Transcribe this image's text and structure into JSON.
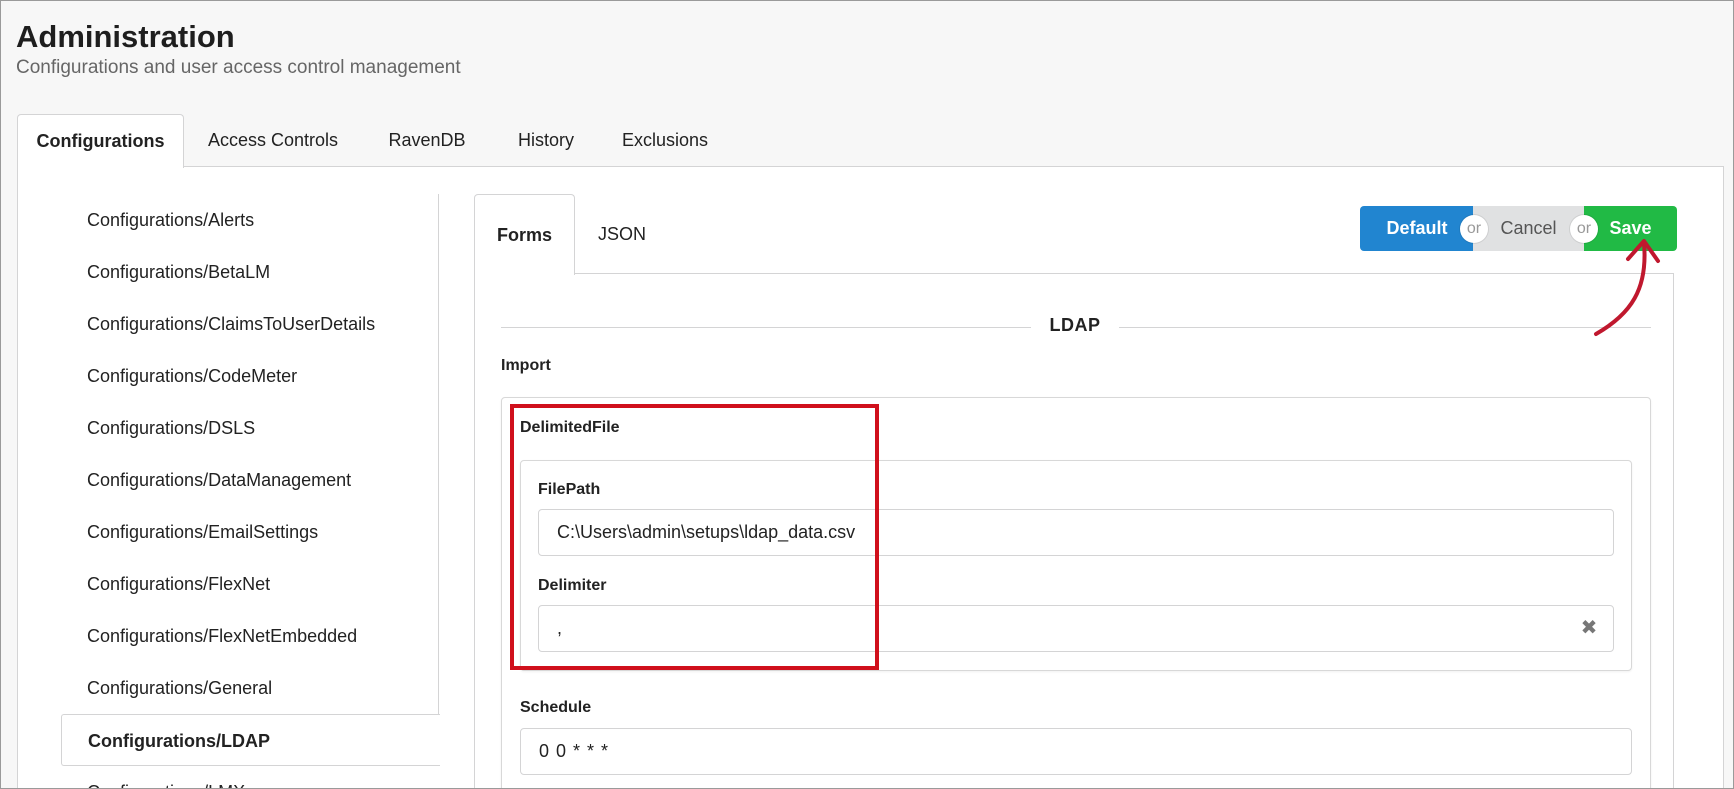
{
  "header": {
    "title": "Administration",
    "subtitle": "Configurations and user access control management"
  },
  "top_tabs": [
    {
      "label": "Configurations",
      "active": true
    },
    {
      "label": "Access Controls",
      "active": false
    },
    {
      "label": "RavenDB",
      "active": false
    },
    {
      "label": "History",
      "active": false
    },
    {
      "label": "Exclusions",
      "active": false
    }
  ],
  "sidebar": {
    "items": [
      {
        "label": "Configurations/Alerts"
      },
      {
        "label": "Configurations/BetaLM"
      },
      {
        "label": "Configurations/ClaimsToUserDetails"
      },
      {
        "label": "Configurations/CodeMeter"
      },
      {
        "label": "Configurations/DSLS"
      },
      {
        "label": "Configurations/DataManagement"
      },
      {
        "label": "Configurations/EmailSettings"
      },
      {
        "label": "Configurations/FlexNet"
      },
      {
        "label": "Configurations/FlexNetEmbedded"
      },
      {
        "label": "Configurations/General"
      },
      {
        "label": "Configurations/LDAP",
        "active": true
      },
      {
        "label": "Configurations/LMX"
      }
    ]
  },
  "inner_tabs": [
    {
      "label": "Forms",
      "active": true
    },
    {
      "label": "JSON",
      "active": false
    }
  ],
  "actions": {
    "default_label": "Default",
    "or_label": "or",
    "cancel_label": "Cancel",
    "save_label": "Save"
  },
  "form": {
    "section_title": "LDAP",
    "import_label": "Import",
    "delimited_file_label": "DelimitedFile",
    "filepath_label": "FilePath",
    "filepath_value": "C:\\Users\\admin\\setups\\ldap_data.csv",
    "delimiter_label": "Delimiter",
    "delimiter_value": ",",
    "schedule_label": "Schedule",
    "schedule_value": "0 0 * * *"
  },
  "colors": {
    "primary": "#2185d0",
    "save": "#21ba45",
    "cancel": "#e0e1e2",
    "annotation": "#d0101c",
    "arrow": "#c0182e"
  },
  "icons": {
    "clear": "close-icon",
    "annotation_arrow": "curved-arrow-icon"
  }
}
